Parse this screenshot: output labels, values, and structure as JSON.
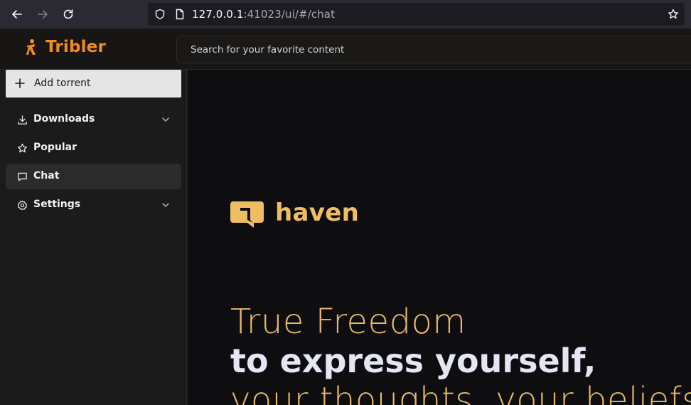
{
  "browser": {
    "url_host": "127.0.0.1",
    "url_rest": ":41023/ui/#/chat"
  },
  "app": {
    "name": "Tribler",
    "search": {
      "placeholder": "Search for your favorite content"
    }
  },
  "sidebar": {
    "add_torrent": "Add torrent",
    "items": [
      {
        "label": "Downloads",
        "icon": "download-icon",
        "expandable": true
      },
      {
        "label": "Popular",
        "icon": "star-icon",
        "expandable": false
      },
      {
        "label": "Chat",
        "icon": "chat-icon",
        "expandable": false,
        "active": true
      },
      {
        "label": "Settings",
        "icon": "gear-icon",
        "expandable": true
      }
    ]
  },
  "main": {
    "brand": "haven",
    "hero": {
      "line1": "True Freedom",
      "line2": "to express yourself,",
      "line3": "your thoughts, your beliefs"
    }
  },
  "colors": {
    "accent": "#f28c1b",
    "haven_gold": "#f0be62",
    "hero_gold": "#e9b86a"
  }
}
